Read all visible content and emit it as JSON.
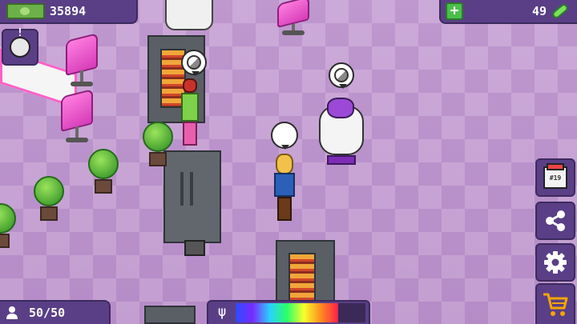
{
  "hud": {
    "money": "35894",
    "energy": "49",
    "population": "50/50",
    "mood_level": 0.79,
    "mood_icon": "ѰΨ"
  },
  "side_menu": {
    "calendar_label": "#19"
  },
  "icons": {
    "money": "cash-stack-icon",
    "energy_add": "plus-icon",
    "energy": "battery-icon",
    "alert": "alert-visitor-icon",
    "population": "person-icon",
    "mood": "cheer-icon",
    "calendar": "calendar-icon",
    "share": "share-icon",
    "settings": "gear-icon",
    "shop": "shopping-cart-icon"
  },
  "colors": {
    "hud_bg": "#5a3f86",
    "floor_light": "#c7a2d5",
    "floor_dark": "#b98fcb",
    "plant": "#4aa532",
    "chair": "#e04cc2"
  }
}
